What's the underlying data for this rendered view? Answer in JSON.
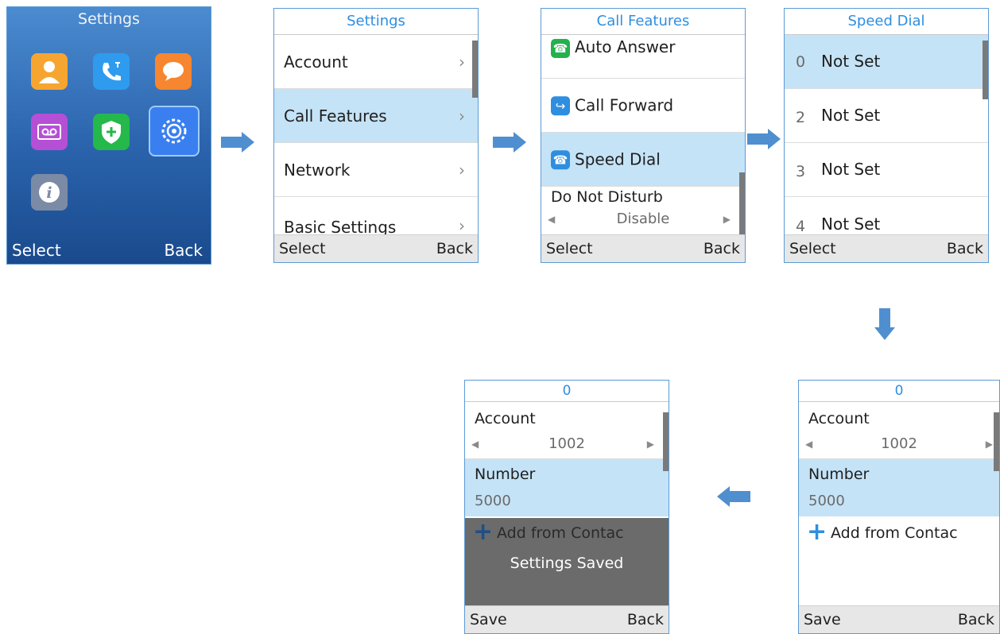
{
  "home": {
    "title": "Settings",
    "softkey_left": "Select",
    "softkey_right": "Back",
    "icons": [
      "contacts-icon",
      "call-history-icon",
      "messages-icon",
      "voicemail-icon",
      "security-icon",
      "settings-icon",
      "info-icon"
    ]
  },
  "settings": {
    "title": "Settings",
    "items": [
      "Account",
      "Call Features",
      "Network",
      "Basic Settings"
    ],
    "softkey_left": "Select",
    "softkey_right": "Back"
  },
  "call_features": {
    "title": "Call Features",
    "items": [
      "Auto Answer",
      "Call Forward",
      "Speed Dial",
      "Do Not Disturb"
    ],
    "dnd_value": "Disable",
    "softkey_left": "Select",
    "softkey_right": "Back"
  },
  "speed_dial": {
    "title": "Speed Dial",
    "entries": [
      {
        "key": "0",
        "label": "Not Set"
      },
      {
        "key": "2",
        "label": "Not Set"
      },
      {
        "key": "3",
        "label": "Not Set"
      },
      {
        "key": "4",
        "label": "Not Set"
      }
    ],
    "softkey_left": "Select",
    "softkey_right": "Back"
  },
  "edit": {
    "title": "0",
    "account_label": "Account",
    "account_value": "1002",
    "number_label": "Number",
    "number_value": "5000",
    "add_label": "Add from Contac",
    "softkey_left": "Save",
    "softkey_right": "Back"
  },
  "saved": {
    "title": "0",
    "account_label": "Account",
    "account_value": "1002",
    "number_label": "Number",
    "number_value": "5000",
    "add_label": "Add from Contac",
    "toast": "Settings Saved",
    "softkey_left": "Save",
    "softkey_right": "Back"
  },
  "colors": {
    "accent": "#2e8ee0",
    "selected": "#c5e3f7",
    "flow_arrow": "#4f8fd0"
  }
}
